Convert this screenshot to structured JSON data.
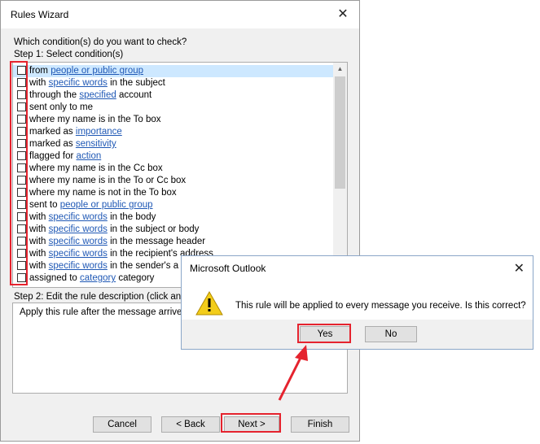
{
  "wizard": {
    "title": "Rules Wizard",
    "question": "Which condition(s) do you want to check?",
    "step1": "Step 1: Select condition(s)",
    "conditions": [
      [
        {
          "t": "from "
        },
        {
          "t": "people or public group",
          "link": true
        }
      ],
      [
        {
          "t": "with "
        },
        {
          "t": "specific words",
          "link": true
        },
        {
          "t": " in the subject"
        }
      ],
      [
        {
          "t": "through the "
        },
        {
          "t": "specified",
          "link": true
        },
        {
          "t": " account"
        }
      ],
      [
        {
          "t": "sent only to me"
        }
      ],
      [
        {
          "t": "where my name is in the To box"
        }
      ],
      [
        {
          "t": "marked as "
        },
        {
          "t": "importance",
          "link": true
        }
      ],
      [
        {
          "t": "marked as "
        },
        {
          "t": "sensitivity",
          "link": true
        }
      ],
      [
        {
          "t": "flagged for "
        },
        {
          "t": "action",
          "link": true
        }
      ],
      [
        {
          "t": "where my name is in the Cc box"
        }
      ],
      [
        {
          "t": "where my name is in the To or Cc box"
        }
      ],
      [
        {
          "t": "where my name is not in the To box"
        }
      ],
      [
        {
          "t": "sent to "
        },
        {
          "t": "people or public group",
          "link": true
        }
      ],
      [
        {
          "t": "with "
        },
        {
          "t": "specific words",
          "link": true
        },
        {
          "t": " in the body"
        }
      ],
      [
        {
          "t": "with "
        },
        {
          "t": "specific words",
          "link": true
        },
        {
          "t": " in the subject or body"
        }
      ],
      [
        {
          "t": "with "
        },
        {
          "t": "specific words",
          "link": true
        },
        {
          "t": " in the message header"
        }
      ],
      [
        {
          "t": "with "
        },
        {
          "t": "specific words",
          "link": true
        },
        {
          "t": " in the recipient's address"
        }
      ],
      [
        {
          "t": "with "
        },
        {
          "t": "specific words",
          "link": true
        },
        {
          "t": " in the sender's a"
        }
      ],
      [
        {
          "t": "assigned to "
        },
        {
          "t": "category",
          "link": true
        },
        {
          "t": " category"
        }
      ]
    ],
    "step2": "Step 2: Edit the rule description (click an",
    "description": "Apply this rule after the message arrive",
    "buttons": {
      "cancel": "Cancel",
      "back": "< Back",
      "next": "Next >",
      "finish": "Finish"
    }
  },
  "dialog": {
    "title": "Microsoft Outlook",
    "message": "This rule will be applied to every message you receive. Is this correct?",
    "yes": "Yes",
    "no": "No"
  },
  "icons": {
    "close": "close-icon",
    "warning": "warning-icon",
    "arrow": "annotation-arrow"
  },
  "colors": {
    "highlight": "#e5232e",
    "link": "#1f58b5",
    "selection": "#cde8ff",
    "warning": "#f3cd1a"
  }
}
